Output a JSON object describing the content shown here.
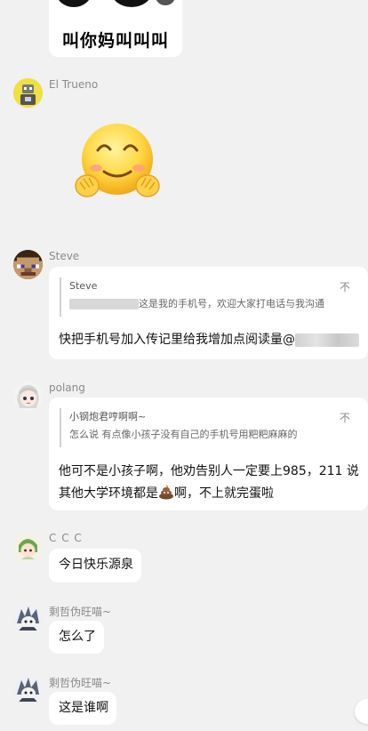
{
  "top_sticker": {
    "caption": "叫你妈叫叫叫"
  },
  "messages": [
    {
      "sender": "El Trueno",
      "type": "sticker",
      "sticker": "blushing-smile-emoji"
    },
    {
      "sender": "Steve",
      "quote": {
        "author": "Steve",
        "text": "这是我的手机号，欢迎大家打电话与我沟通"
      },
      "text": "快把手机号加入传记里给我增加点阅读量@"
    },
    {
      "sender": "polang",
      "quote": {
        "author": "小钢炮君哼啊啊~",
        "text": "怎么说 有点像小孩子没有自己的手机号用粑粑麻麻的"
      },
      "text_line1": "他可不是小孩子啊，他劝告别人一定要上985，211 说",
      "text_line2a": "其他大学环境都是",
      "text_line2b": "啊，不上就完蛋啦"
    },
    {
      "sender": "C C C",
      "text": "今日快乐源泉"
    },
    {
      "sender": "剩哲伪旺喵~",
      "text": "怎么了"
    },
    {
      "sender": "剩哲伪旺喵~",
      "text": "这是谁啊"
    }
  ],
  "quote_close_glyph": "不",
  "colors": {
    "background": "#f1f1f1",
    "bubble": "#ffffff",
    "name": "#8a8a8a"
  }
}
